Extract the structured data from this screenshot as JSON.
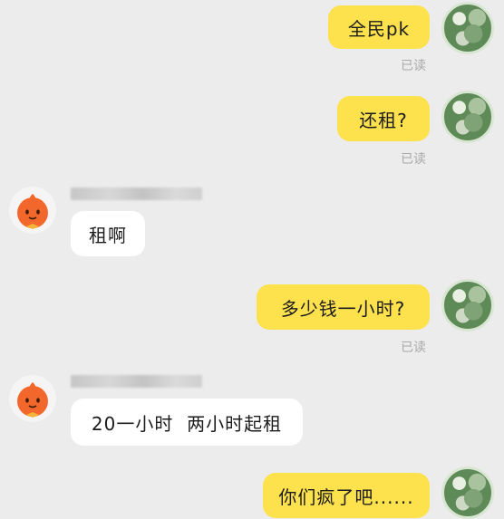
{
  "messages": [
    {
      "sender": "me",
      "text": "全民pk",
      "status": "已读"
    },
    {
      "sender": "me",
      "text": "还租?",
      "status": "已读"
    },
    {
      "sender": "other",
      "text": "租啊"
    },
    {
      "sender": "me",
      "text": "多少钱一小时?",
      "status": "已读"
    },
    {
      "sender": "other",
      "text": "20一小时  两小时起租"
    },
    {
      "sender": "me",
      "text": "你们疯了吧......"
    }
  ],
  "colors": {
    "outgoing_bubble": "#fde14d",
    "incoming_bubble": "#ffffff",
    "background": "#ececec",
    "read_status": "#a9a9a9",
    "other_avatar": "#f2682c"
  },
  "icons": {
    "my_avatar": "user-avatar-photo",
    "other_avatar": "orange-mascot-avatar"
  }
}
